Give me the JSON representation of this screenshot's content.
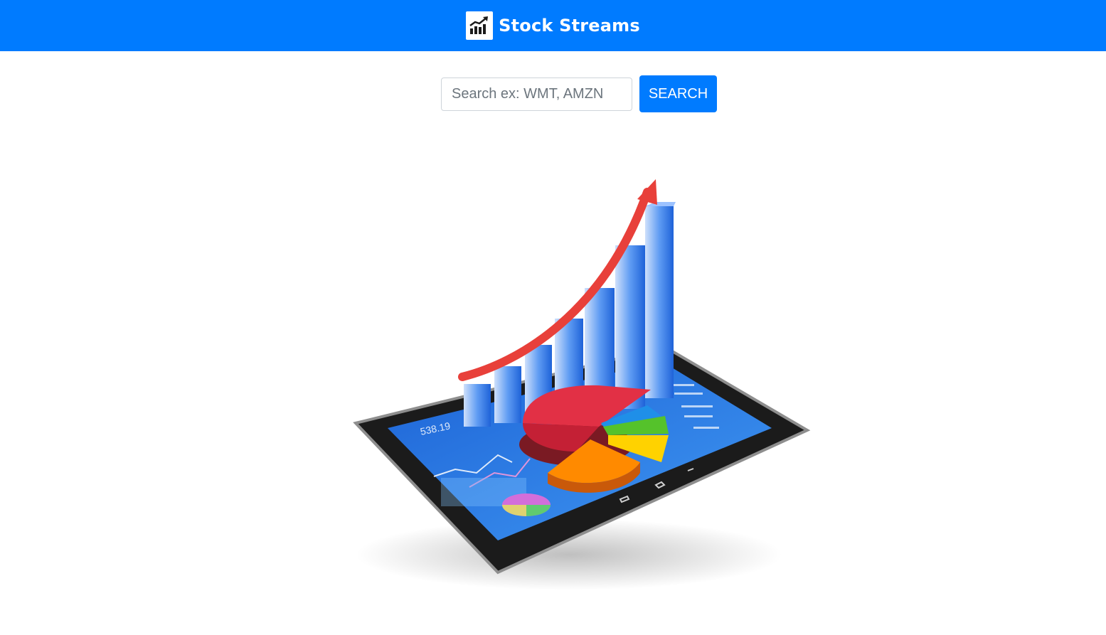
{
  "navbar": {
    "brand_title": "Stock Streams",
    "brand_icon": "chart-growth-icon",
    "background": "#007bff"
  },
  "search": {
    "placeholder": "Search ex: WMT, AMZN",
    "value": "",
    "button_label": "SEARCH",
    "button_color": "#007bff"
  },
  "hero": {
    "image": "tablet-finance-illustration",
    "screen_value": "538.19",
    "colors": {
      "arrow": "#e8403a",
      "bars": "#2a7bf0",
      "pie_red": "#e23045",
      "pie_orange": "#ff8a00",
      "pie_yellow": "#ffd200",
      "pie_green": "#55c22b",
      "pie_blue": "#1f8fe8",
      "tablet": "#1b1b1b"
    }
  }
}
